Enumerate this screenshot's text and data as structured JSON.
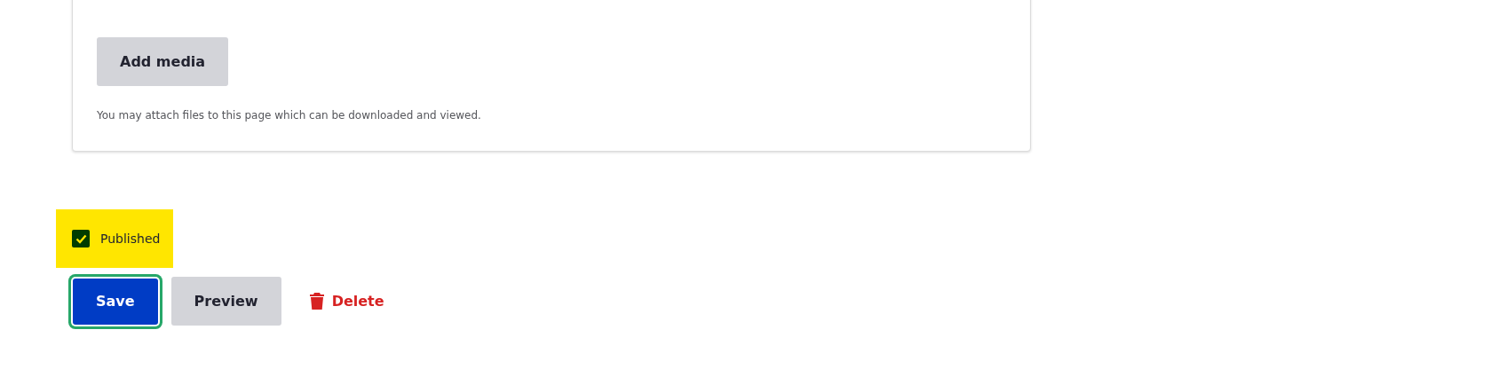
{
  "media": {
    "button": "Add media",
    "help": "You may attach files to this page which can be downloaded and viewed."
  },
  "published": {
    "label": "Published",
    "checked": true,
    "highlighted": true
  },
  "actions": [
    {
      "kind": "primary",
      "label": "Save",
      "focused": true
    },
    {
      "kind": "secondary",
      "label": "Preview",
      "focused": false
    },
    {
      "kind": "danger",
      "label": "Delete",
      "focused": false
    }
  ]
}
